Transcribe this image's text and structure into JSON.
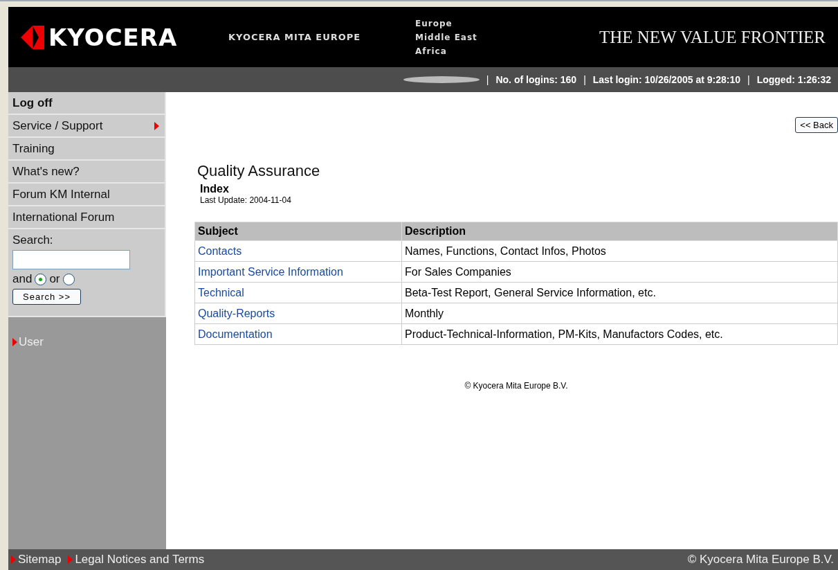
{
  "header": {
    "logo": "KYOCERA",
    "company": "KYOCERA MITA EUROPE",
    "regions": [
      "Europe",
      "Middle East",
      "Africa"
    ],
    "slogan": "THE NEW VALUE FRONTIER"
  },
  "status_bar": {
    "items": [
      "No. of logins: 160",
      "Last login: 10/26/2005 at 9:28:10",
      "Logged: 1:26:32"
    ],
    "separator": "|"
  },
  "sidebar": {
    "items": [
      {
        "label": "Log off",
        "bold": true,
        "submenu": false
      },
      {
        "label": "Service / Support",
        "bold": false,
        "submenu": true
      },
      {
        "label": "Training",
        "bold": false,
        "submenu": false
      },
      {
        "label": "What's new?",
        "bold": false,
        "submenu": false
      },
      {
        "label": "Forum KM Internal",
        "bold": false,
        "submenu": false
      },
      {
        "label": "International Forum",
        "bold": false,
        "submenu": false
      }
    ],
    "search": {
      "label": "Search:",
      "options": [
        {
          "label": "and",
          "selected": true
        },
        {
          "label": "or",
          "selected": false
        }
      ],
      "button": "Search >>"
    },
    "user_link": "User"
  },
  "back_button": "<< Back",
  "page": {
    "title": "Quality Assurance",
    "subtitle": "Index",
    "last_update": "Last Update: 2004-11-04"
  },
  "table": {
    "columns": [
      "Subject",
      "Description"
    ],
    "rows": [
      {
        "subject": "Contacts",
        "description": "Names, Functions, Contact Infos, Photos"
      },
      {
        "subject": "Important Service Information",
        "description": "For Sales Companies"
      },
      {
        "subject": "Technical",
        "description": "Beta-Test Report, General Service Information, etc."
      },
      {
        "subject": "Quality-Reports",
        "description": "Monthly"
      },
      {
        "subject": "Documentation",
        "description": "Product-Technical-Information, PM-Kits, Manufactors Codes, etc."
      }
    ]
  },
  "copyright": "© Kyocera Mita Europe B.V.",
  "footer": {
    "links": [
      "Sitemap",
      "Legal Notices and Terms"
    ],
    "copyright": "© Kyocera Mita Europe B.V."
  }
}
